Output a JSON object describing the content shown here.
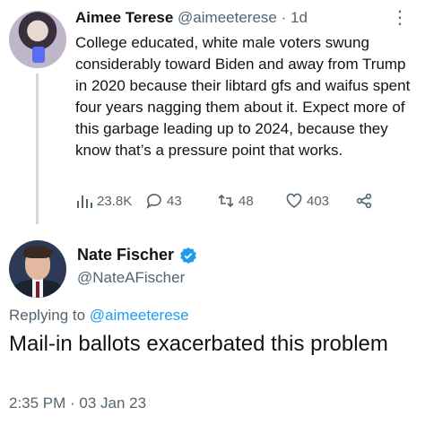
{
  "parent_tweet": {
    "author_name": "Aimee Terese",
    "handle": "@aimeeterese",
    "time": "1d",
    "text": "College educated, white male voters swung considerably toward Biden and away from Trump in 2020 because their libtard gfs and waifus spent four years nagging them about it. Expect more of this garbage leading up to 2024, because they know that’s a pressure point that works.",
    "stats": {
      "views": "23.8K",
      "replies": "43",
      "retweets": "48",
      "likes": "403"
    }
  },
  "reply_tweet": {
    "author_name": "Nate Fischer",
    "handle": "@NateAFischer",
    "replying_to_prefix": "Replying to",
    "replying_to_handle": "@aimeeterese",
    "text": "Mail-in ballots exacerbated this problem",
    "timestamp": "2:35 PM · 03 Jan 23"
  },
  "colors": {
    "text": "#0f1419",
    "secondary": "#536471",
    "link": "#1d9bf0",
    "verified": "#1d9bf0"
  },
  "icons": [
    "more-icon",
    "views-icon",
    "reply-icon",
    "retweet-icon",
    "like-icon",
    "share-icon",
    "verified-badge-icon"
  ]
}
